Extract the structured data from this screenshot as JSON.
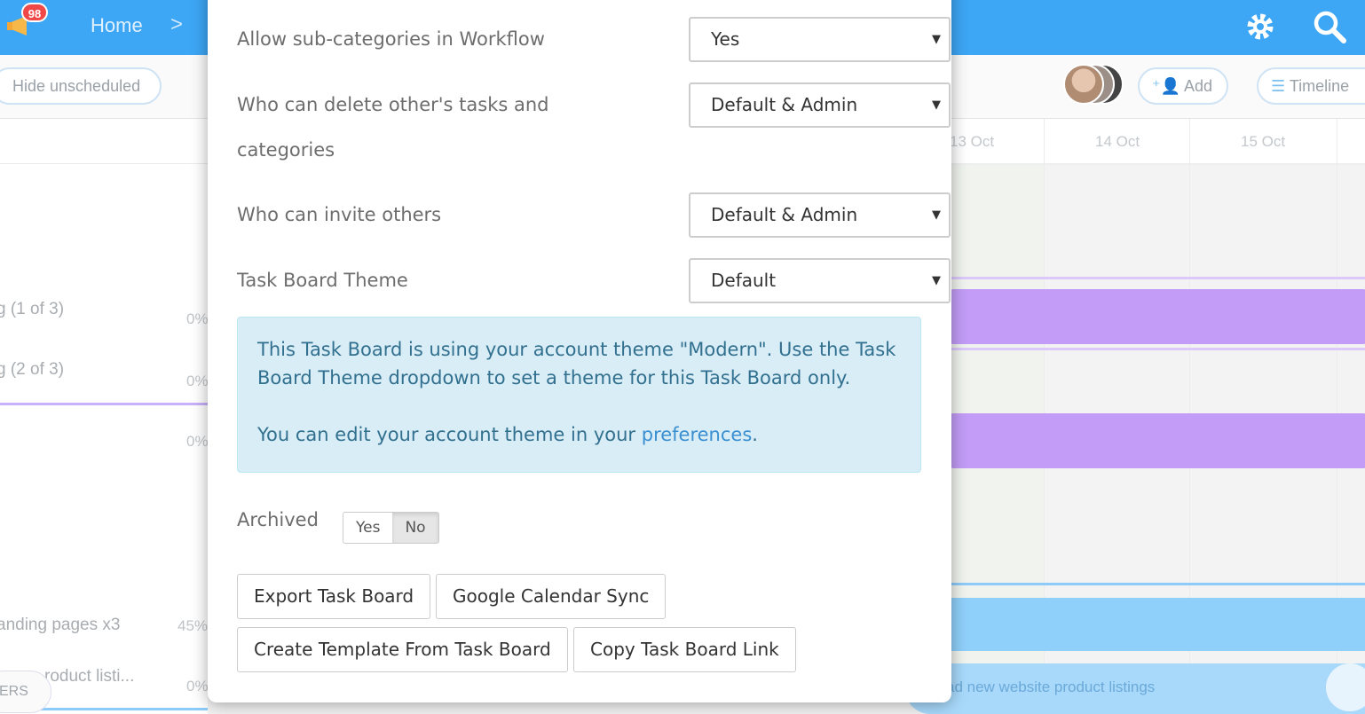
{
  "background": {
    "notification_count": "98",
    "breadcrumb_home": "Home",
    "breadcrumb_sep": ">",
    "hide_unscheduled": "Hide unscheduled",
    "add": "Add",
    "timeline": "Timeline",
    "dates": [
      "13 Oct",
      "14 Oct",
      "15 Oct"
    ],
    "left_rows": [
      {
        "label": "g (1 of 3)",
        "pct": "0%"
      },
      {
        "label": "g (2 of 3)",
        "pct": "0%"
      },
      {
        "label": "",
        "pct": "0%"
      },
      {
        "label": "anding pages x3",
        "pct": "45%"
      },
      {
        "label": "roduct listi...",
        "pct": "0%"
      }
    ],
    "filters": "ERS",
    "bottom_bar_text": "ad new website product listings",
    "colors": {
      "topbar": "#3da6f5",
      "gantt_purple": "#c29cf6",
      "gantt_blue": "#8fd0fb"
    }
  },
  "modal": {
    "settings": [
      {
        "label": "Allow sub-categories in Workflow",
        "value": "Yes"
      },
      {
        "label_line1": "Who can delete other's tasks and",
        "label_line2": "categories",
        "value": "Default & Admin"
      },
      {
        "label": "Who can invite others",
        "value": "Default & Admin"
      },
      {
        "label": "Task Board Theme",
        "value": "Default"
      }
    ],
    "dropdown_arrow": "▼",
    "info": {
      "text1": "This Task Board is using your account theme \"Modern\". Use the Task Board Theme dropdown to set a theme for this Task Board only.",
      "text2_prefix": "You can edit your account theme in your ",
      "text2_link": "preferences",
      "text2_suffix": "."
    },
    "archived": {
      "label": "Archived",
      "yes": "Yes",
      "no": "No",
      "selected": "No"
    },
    "buttons": {
      "export": "Export Task Board",
      "gcal": "Google Calendar Sync",
      "template": "Create Template From Task Board",
      "copy_link": "Copy Task Board Link"
    }
  }
}
